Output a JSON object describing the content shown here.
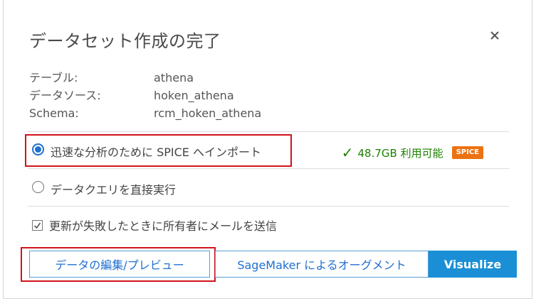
{
  "dialog": {
    "title": "データセット作成の完了",
    "close_icon": "close-icon"
  },
  "info": [
    {
      "label": "テーブル:",
      "value": "athena"
    },
    {
      "label": "データソース:",
      "value": "hoken_athena"
    },
    {
      "label": "Schema:",
      "value": "rcm_hoken_athena"
    }
  ],
  "options": {
    "spice_import": {
      "label": "迅速な分析のために SPICE へインポート",
      "selected": true
    },
    "direct_query": {
      "label": "データクエリを直接実行",
      "selected": false
    }
  },
  "capacity": {
    "text": "48.7GB 利用可能",
    "badge": "SPICE",
    "icon": "check-icon",
    "color": "#1d8102",
    "badge_color": "#ec7211"
  },
  "notify": {
    "label": "更新が失敗したときに所有者にメールを送信",
    "checked": true
  },
  "buttons": {
    "edit_preview": "データの編集/プレビュー",
    "sagemaker": "SageMaker によるオーグメント",
    "visualize": "Visualize"
  },
  "colors": {
    "accent": "#1a8fd6",
    "highlight": "#d0141b"
  }
}
